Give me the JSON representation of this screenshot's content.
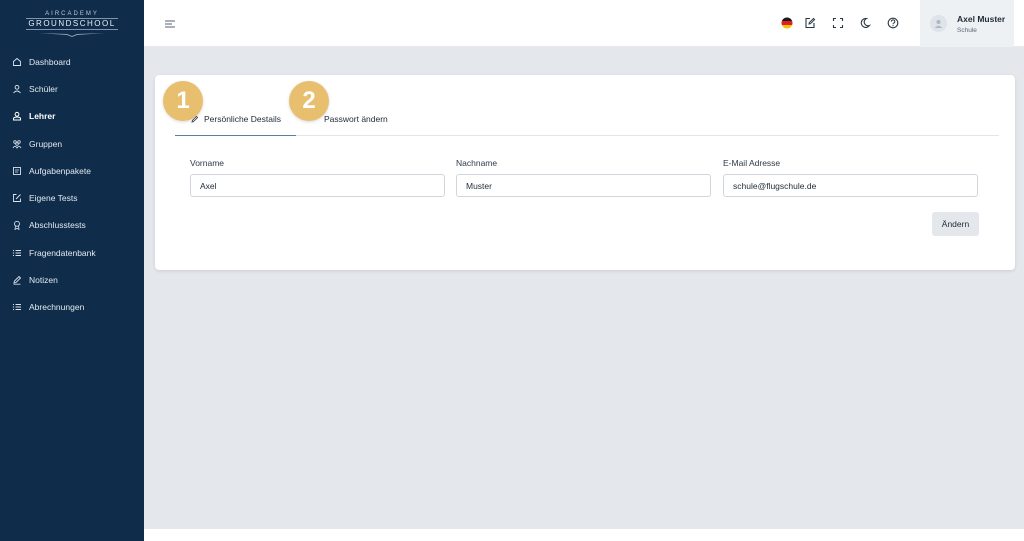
{
  "app": {
    "logo_top": "AIRCADEMY",
    "logo_main": "GROUNDSCHOOL"
  },
  "sidebar": {
    "items": [
      {
        "label": "Dashboard",
        "icon": "home-icon"
      },
      {
        "label": "Schüler",
        "icon": "user-icon"
      },
      {
        "label": "Lehrer",
        "icon": "teacher-icon",
        "active": true
      },
      {
        "label": "Gruppen",
        "icon": "group-icon"
      },
      {
        "label": "Aufgabenpakete",
        "icon": "package-icon"
      },
      {
        "label": "Eigene Tests",
        "icon": "edit-square-icon"
      },
      {
        "label": "Abschlusstests",
        "icon": "award-icon"
      },
      {
        "label": "Fragendatenbank",
        "icon": "list-icon"
      },
      {
        "label": "Notizen",
        "icon": "pencil-icon"
      },
      {
        "label": "Abrechnungen",
        "icon": "list-icon"
      }
    ]
  },
  "header": {
    "icons": [
      "menu-icon",
      "german-flag-icon",
      "edit-icon",
      "fullscreen-icon",
      "moon-icon",
      "help-icon"
    ],
    "user_name": "Axel Muster",
    "user_role": "Schule"
  },
  "tabs": [
    {
      "label": "Persönliche Destails",
      "badge": "1"
    },
    {
      "label": "Passwort ändern",
      "badge": "2"
    }
  ],
  "form": {
    "first_name": {
      "label": "Vorname",
      "value": "Axel"
    },
    "last_name": {
      "label": "Nachname",
      "value": "Muster"
    },
    "email": {
      "label": "E-Mail Adresse",
      "value": "schule@flugschule.de"
    },
    "submit_label": "Ändern"
  },
  "colors": {
    "sidebar_bg": "#0f2d4a",
    "main_bg": "#e4e8ec",
    "badge": "#e7bf6e",
    "tab_underline": "#5b7fa3"
  }
}
